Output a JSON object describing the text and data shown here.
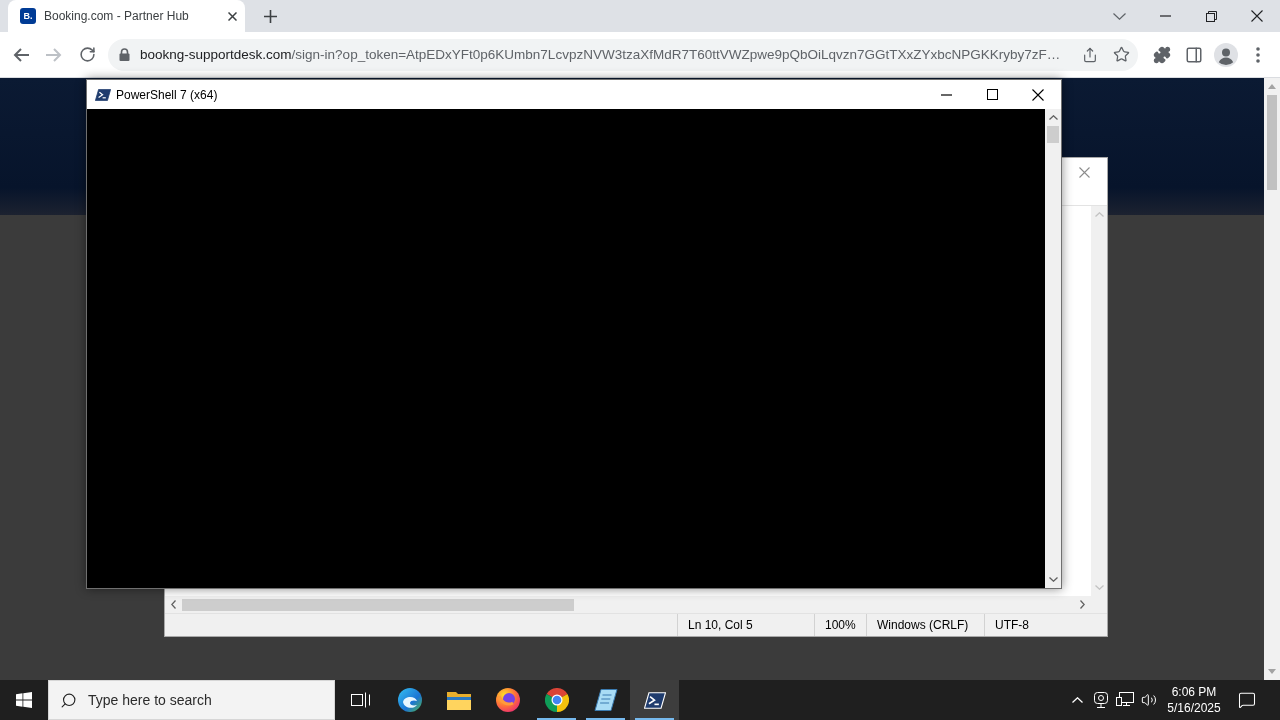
{
  "browser": {
    "tabs": [
      {
        "favicon_text": "B.",
        "title": "Booking.com - Partner Hub",
        "selected": true
      }
    ],
    "navigation": {
      "back": {
        "disabled": false
      },
      "forward": {
        "disabled": true
      }
    },
    "address_bar": {
      "host": "bookng-supportdesk.com",
      "path": "/sign-in?op_token=AtpEDxYFt0p6KUmbn7LcvpzNVW3tzaXfMdR7T60ttVWZpwe9pQbOiLqvzn7GGtTXxZYxbcNPGKKryby7zF…"
    }
  },
  "powershell_window": {
    "title": "PowerShell 7 (x64)"
  },
  "notepad_window": {
    "status_bar": [
      "Ln 10, Col 5",
      "100%",
      "Windows (CRLF)",
      "UTF-8"
    ]
  },
  "taskbar": {
    "search": {
      "placeholder": "Type here to search"
    },
    "apps": [
      {
        "kind": "taskview",
        "running": false,
        "selected": false
      },
      {
        "kind": "edge",
        "running": false,
        "selected": false
      },
      {
        "kind": "explorer",
        "running": false,
        "selected": false
      },
      {
        "kind": "firefox",
        "running": false,
        "selected": false
      },
      {
        "kind": "chrome",
        "running": true,
        "selected": false
      },
      {
        "kind": "notepad",
        "running": true,
        "selected": false
      },
      {
        "kind": "powershell",
        "running": true,
        "selected": true
      }
    ],
    "clock": {
      "time": "6:06 PM",
      "date": "5/16/2025"
    }
  }
}
